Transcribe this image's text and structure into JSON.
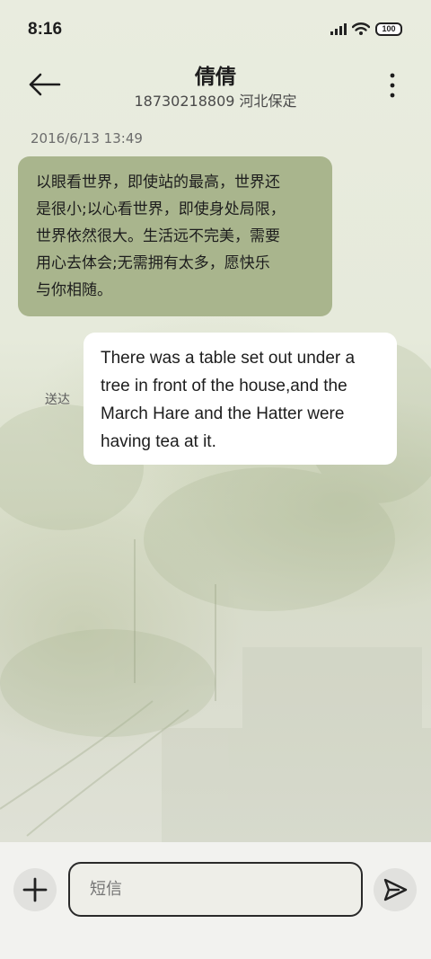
{
  "status_bar": {
    "time": "8:16",
    "battery": "100",
    "signal_icon": "signal-bars-icon",
    "wifi_icon": "wifi-icon"
  },
  "header": {
    "contact_name": "倩倩",
    "contact_sub": "18730218809 河北保定",
    "back_icon": "arrow-left-icon",
    "more_icon": "more-vertical-icon"
  },
  "conversation": {
    "timestamp": "2016/6/13 13:49",
    "incoming": {
      "lines": [
        "以眼看世界，即使站的最高，世界还",
        "是很小;以心看世界，即使身处局限，",
        "世界依然很大。生活远不完美，需要",
        "用心去体会;无需拥有太多，愿快乐",
        "与你相随。"
      ]
    },
    "outgoing": {
      "status": "送达",
      "lines": [
        "There was a table set out under a",
        "tree in front of the house,and the",
        "March Hare and the Hatter were",
        "having tea at it."
      ]
    }
  },
  "composer": {
    "placeholder": "短信",
    "add_icon": "plus-icon",
    "send_icon": "send-icon"
  },
  "colors": {
    "incoming_bubble": "#a9b58d",
    "outgoing_bubble": "#ffffff",
    "background": "#e8ebdc"
  }
}
